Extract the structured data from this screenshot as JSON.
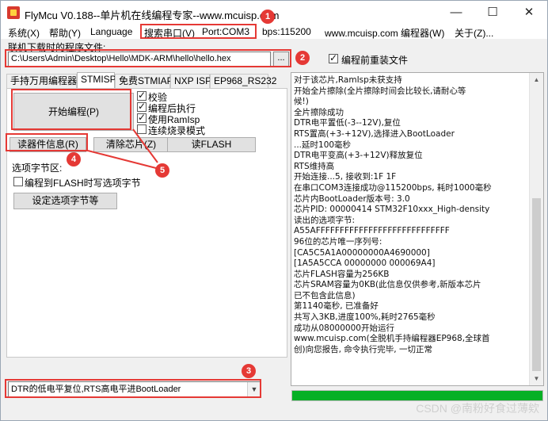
{
  "window": {
    "title": "FlyMcu V0.188--单片机在线编程专家--www.mcuisp.com",
    "min_glyph": "—",
    "max_glyph": "☐",
    "close_glyph": "✕"
  },
  "menu": {
    "items": [
      "系统(X)",
      "帮助(Y)",
      "Language",
      "搜索串口(V)",
      "Port:COM3",
      "bps:115200",
      "www.mcuisp.com 编程器(W)",
      "关于(Z)..."
    ]
  },
  "file": {
    "label": "联机下载时的程序文件:",
    "path": "C:\\Users\\Admin\\Desktop\\Hello\\MDK-ARM\\hello\\hello.hex",
    "browse_label": "...",
    "reload_label": "编程前重装文件"
  },
  "tabs": [
    "手持万用编程器",
    "STMISP",
    "免费STMIAP",
    "NXP ISP",
    "EP968_RS232"
  ],
  "stmisp": {
    "start_label": "开始编程(P)",
    "options": [
      "校验",
      "编程后执行",
      "使用RamIsp",
      "连续烧录模式"
    ],
    "read_info_label": "读器件信息(R)",
    "erase_label": "清除芯片(Z)",
    "read_flash_label": "读FLASH",
    "option_group_label": "选项字节区:",
    "write_option_label": "编程到FLASH时写选项字节",
    "set_option_label": "设定选项字节等"
  },
  "reset_mode": {
    "selected": "DTR的低电平复位,RTS高电平进BootLoader",
    "arrow_glyph": "▼"
  },
  "log": [
    "对于该芯片,RamIsp未获支持",
    "开始全片擦除(全片擦除时间会比较长,请耐心等",
    "候!)",
    "全片擦除成功",
    "DTR电平置低(-3--12V),复位",
    "RTS置高(+3-+12V),选择进入BootLoader",
    "...延时100毫秒",
    "DTR电平变高(+3-+12V)释放复位",
    "RTS维持高",
    "开始连接...5, 接收到:1F 1F",
    "在串口COM3连接成功@115200bps, 耗时1000毫秒",
    "芯片内BootLoader版本号: 3.0",
    "芯片PID: 00000414  STM32F10xxx_High-density",
    "读出的选项字节:",
    "A55AFFFFFFFFFFFFFFFFFFFFFFFFFFFF",
    "96位的芯片唯一序列号:",
    "[CA5C5A1A00000000A4690000]",
    "[1A5A5CCA 00000000 000069A4]",
    "芯片FLASH容量为256KB",
    "芯片SRAM容量为0KB(此信息仅供参考,新版本芯片",
    "已不包含此信息)",
    "第1140毫秒, 已准备好",
    "共写入3KB,进度100%,耗时2765毫秒",
    "成功从08000000开始运行",
    "www.mcuisp.com(全脱机手持编程器EP968,全球首",
    "创)向您报告, 命令执行完毕, 一切正常"
  ],
  "scroll": {
    "up_glyph": "▲",
    "down_glyph": "▼"
  },
  "progress": {
    "value": 1.0,
    "color": "#06b025"
  },
  "annotations": {
    "labels": [
      "1",
      "2",
      "3",
      "4",
      "5"
    ],
    "color": "#e53935"
  },
  "watermark": "CSDN @南粉好食过薄欸"
}
